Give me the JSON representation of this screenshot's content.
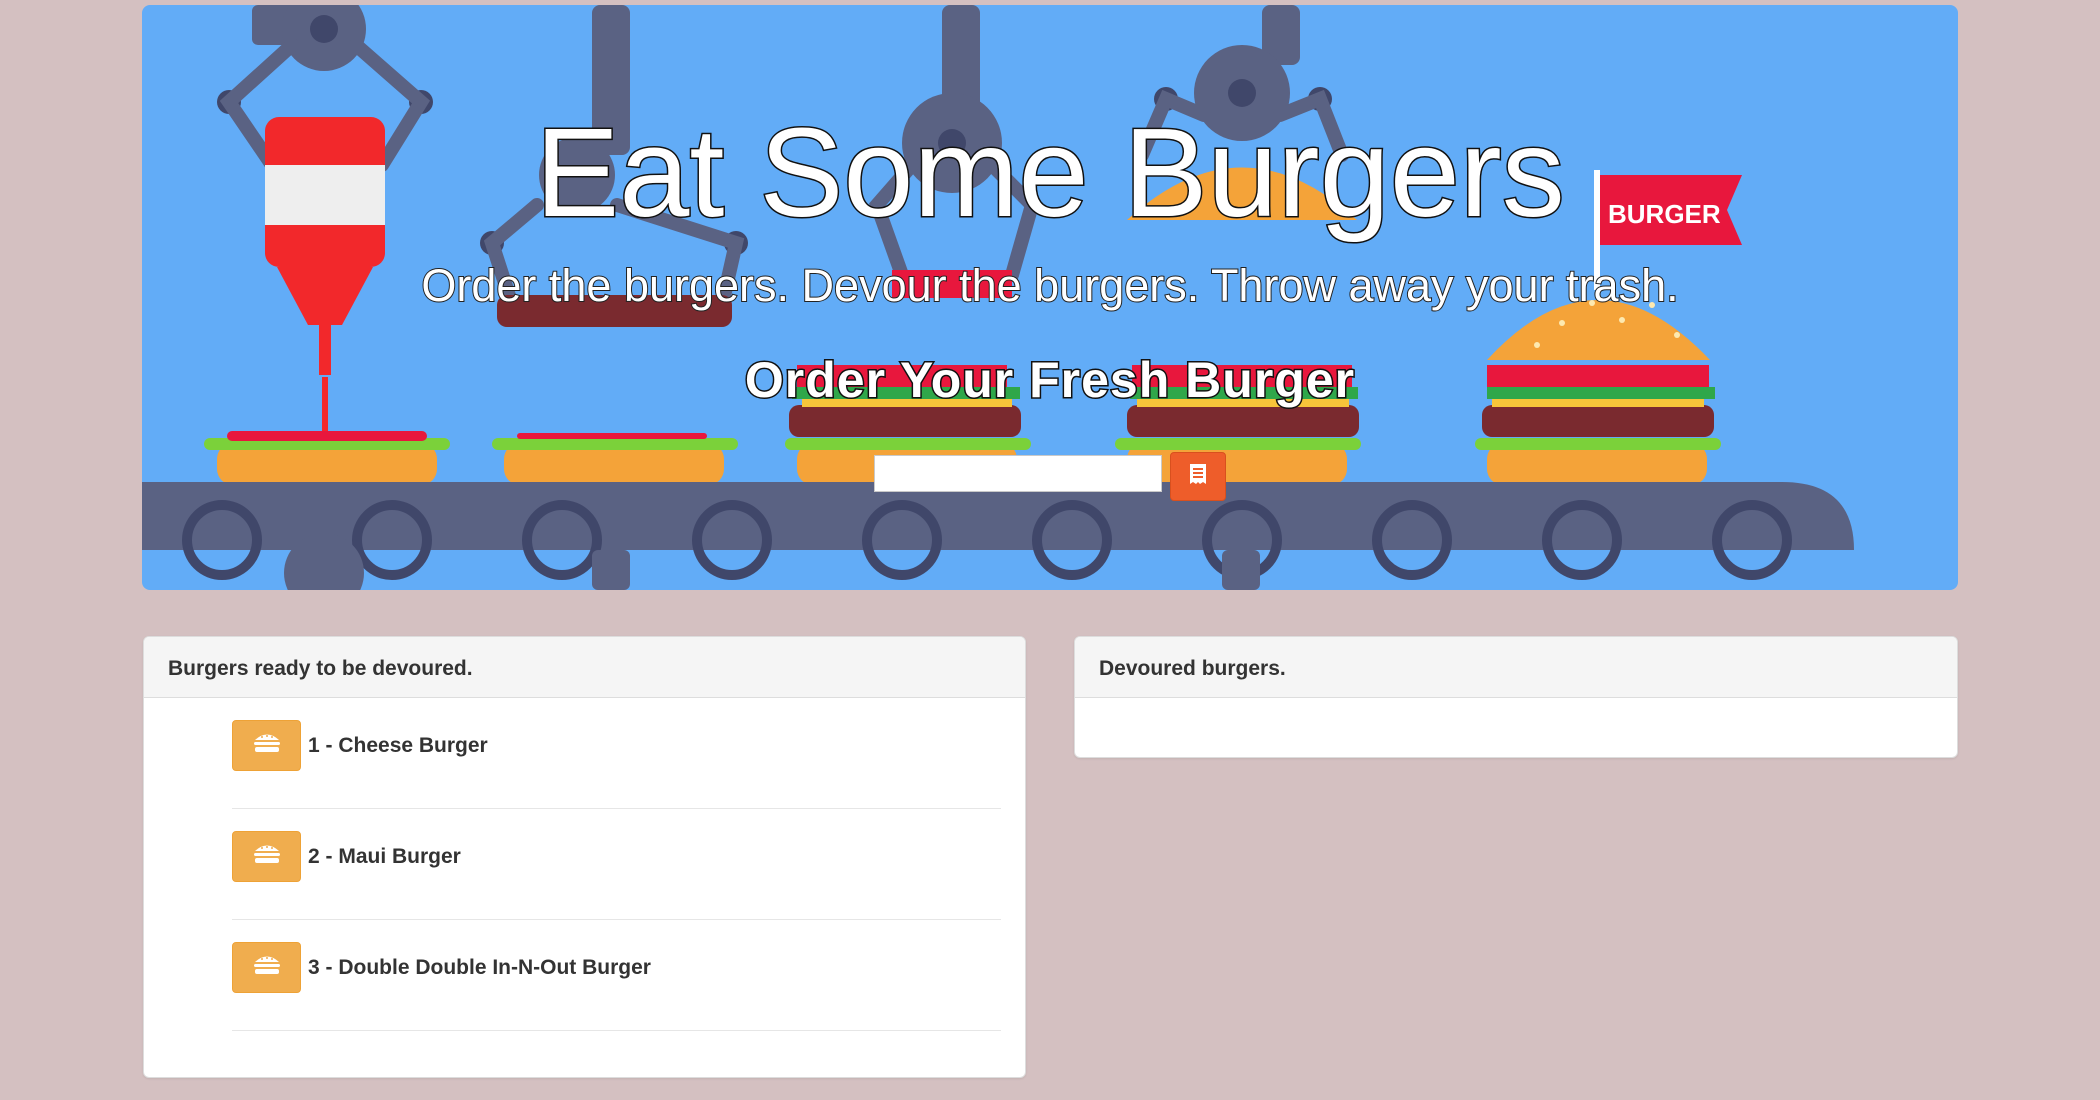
{
  "hero": {
    "title": "Eat Some Burgers",
    "subtitle": "Order the burgers. Devour the burgers. Throw away your trash.",
    "form_label": "Order Your Fresh Burger",
    "flag_text": "BURGER",
    "order_input": {
      "value": "",
      "placeholder": ""
    },
    "order_button_icon": "receipt-icon",
    "colors": {
      "sky": "#62acf7",
      "belt": "#5a6283",
      "order_button": "#ee5d2a"
    }
  },
  "ready_panel": {
    "heading": "Burgers ready to be devoured.",
    "devour_icon": "burger-icon",
    "devour_button_color": "#f0ad4e",
    "items": [
      {
        "label": "1 - Cheese Burger"
      },
      {
        "label": "2 - Maui Burger"
      },
      {
        "label": "3 - Double Double In-N-Out Burger"
      }
    ]
  },
  "devoured_panel": {
    "heading": "Devoured burgers.",
    "items": []
  }
}
